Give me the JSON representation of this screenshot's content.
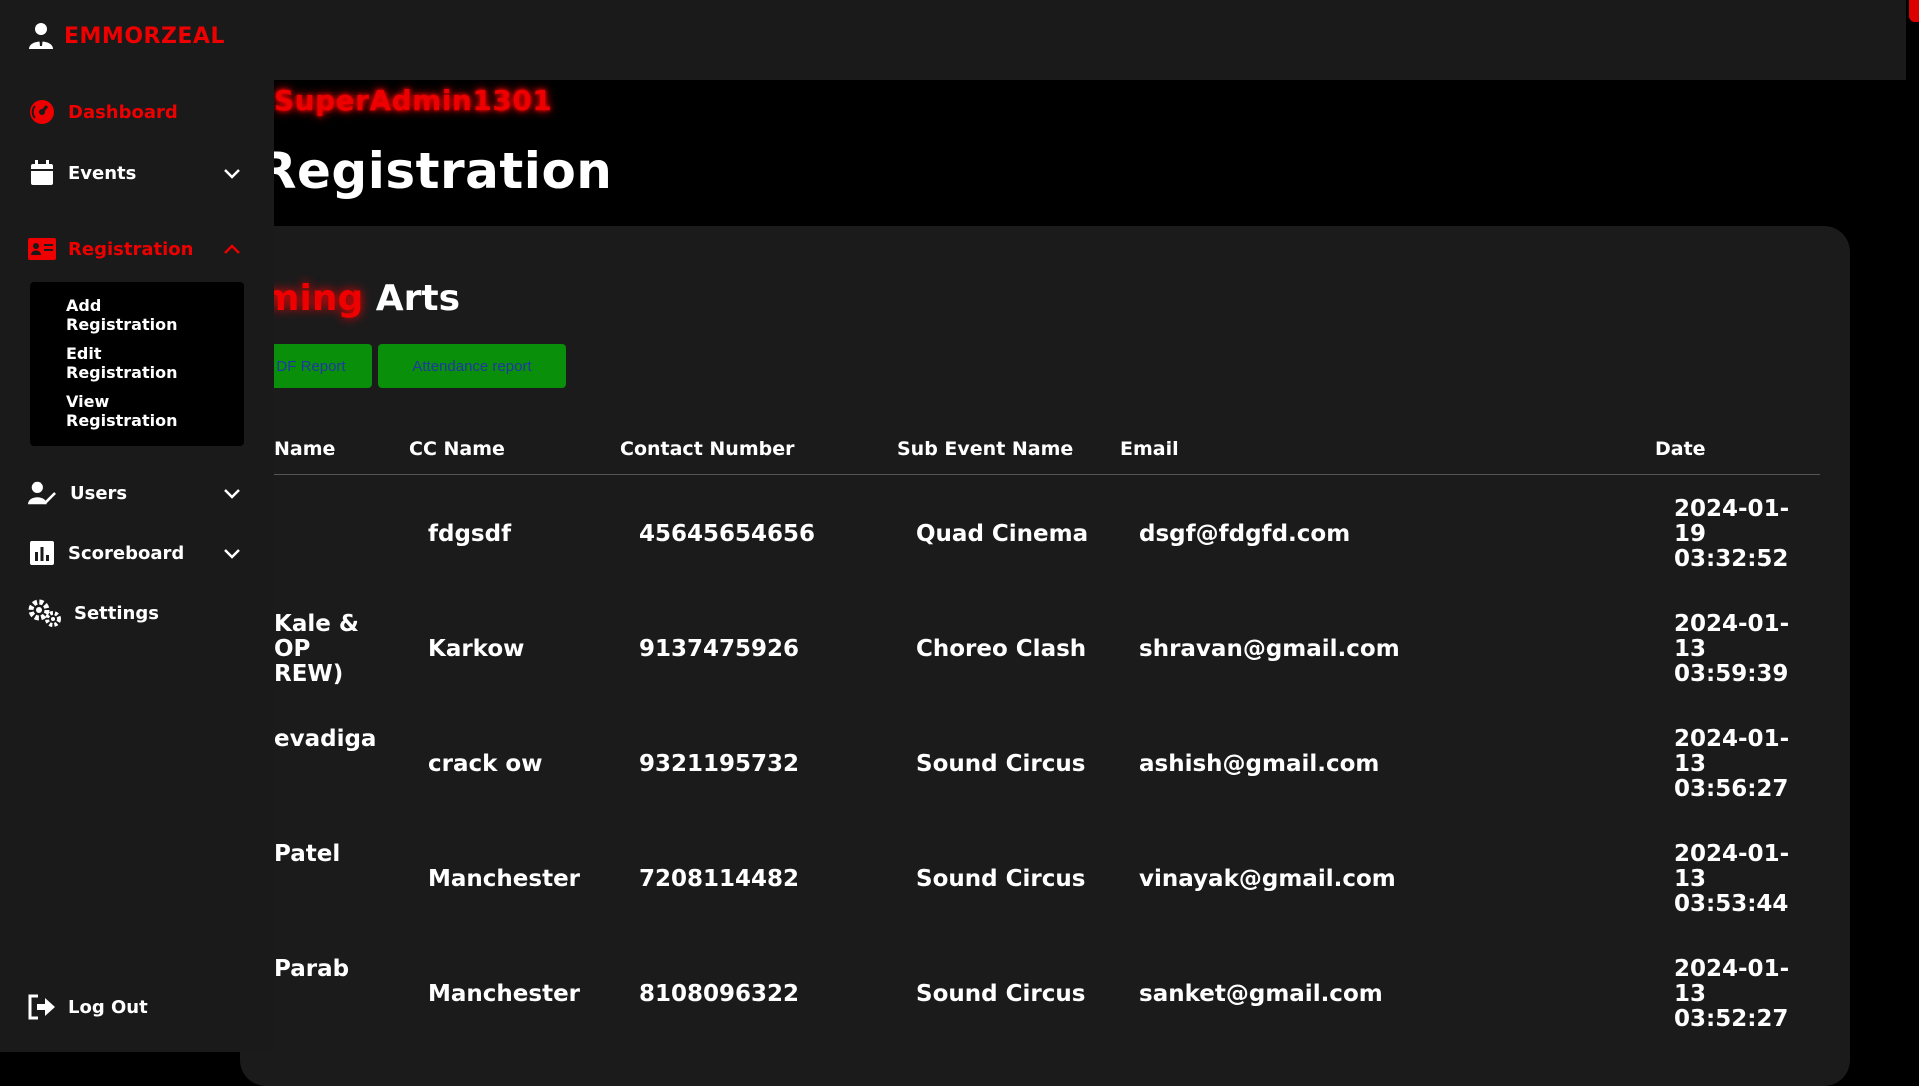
{
  "brand": {
    "name": "EMMORZEAL"
  },
  "sidebar": {
    "items": [
      {
        "label": "Dashboard"
      },
      {
        "label": "Events"
      },
      {
        "label": "Registration"
      },
      {
        "label": "Users"
      },
      {
        "label": "Scoreboard"
      },
      {
        "label": "Settings"
      }
    ],
    "registration_sub": [
      {
        "line1": "Add",
        "line2": "Registration"
      },
      {
        "line1": "Edit",
        "line2": "Registration"
      },
      {
        "line1": "View",
        "line2": "Registration"
      }
    ],
    "logout": "Log Out"
  },
  "header": {
    "welcome": "SuperAdmin1301",
    "title": "Registration"
  },
  "card": {
    "title_red": "ming",
    "title_white": "Arts",
    "pdf_button": "DF Report",
    "attendance_button": "Attendance report"
  },
  "table": {
    "columns": [
      "Name",
      "CC Name",
      "Contact Number",
      "Sub Event Name",
      "Email",
      "Date"
    ],
    "rows": [
      {
        "name": "",
        "cc": "fdgsdf",
        "contact": "45645654656",
        "sub": "Quad Cinema",
        "email": "dsgf@fdgfd.com",
        "d1": "2024-01-",
        "d2": "19",
        "d3": "03:32:52"
      },
      {
        "name": "Kale &\nOP\nREW)",
        "cc": "Karkow",
        "contact": "9137475926",
        "sub": "Choreo Clash",
        "email": "shravan@gmail.com",
        "d1": "2024-01-",
        "d2": "13",
        "d3": "03:59:39"
      },
      {
        "name": "evadiga",
        "cc": "crack ow",
        "contact": "9321195732",
        "sub": "Sound Circus",
        "email": "ashish@gmail.com",
        "d1": "2024-01-",
        "d2": "13",
        "d3": "03:56:27"
      },
      {
        "name": "Patel",
        "cc": "Manchester",
        "contact": "7208114482",
        "sub": "Sound Circus",
        "email": "vinayak@gmail.com",
        "d1": "2024-01-",
        "d2": "13",
        "d3": "03:53:44"
      },
      {
        "name": "Parab",
        "cc": "Manchester",
        "contact": "8108096322",
        "sub": "Sound Circus",
        "email": "sanket@gmail.com",
        "d1": "2024-01-",
        "d2": "13",
        "d3": "03:52:27"
      }
    ]
  },
  "colors": {
    "accent": "#e00000",
    "button": "#0a8f0a",
    "button_text": "#1f38a5"
  }
}
